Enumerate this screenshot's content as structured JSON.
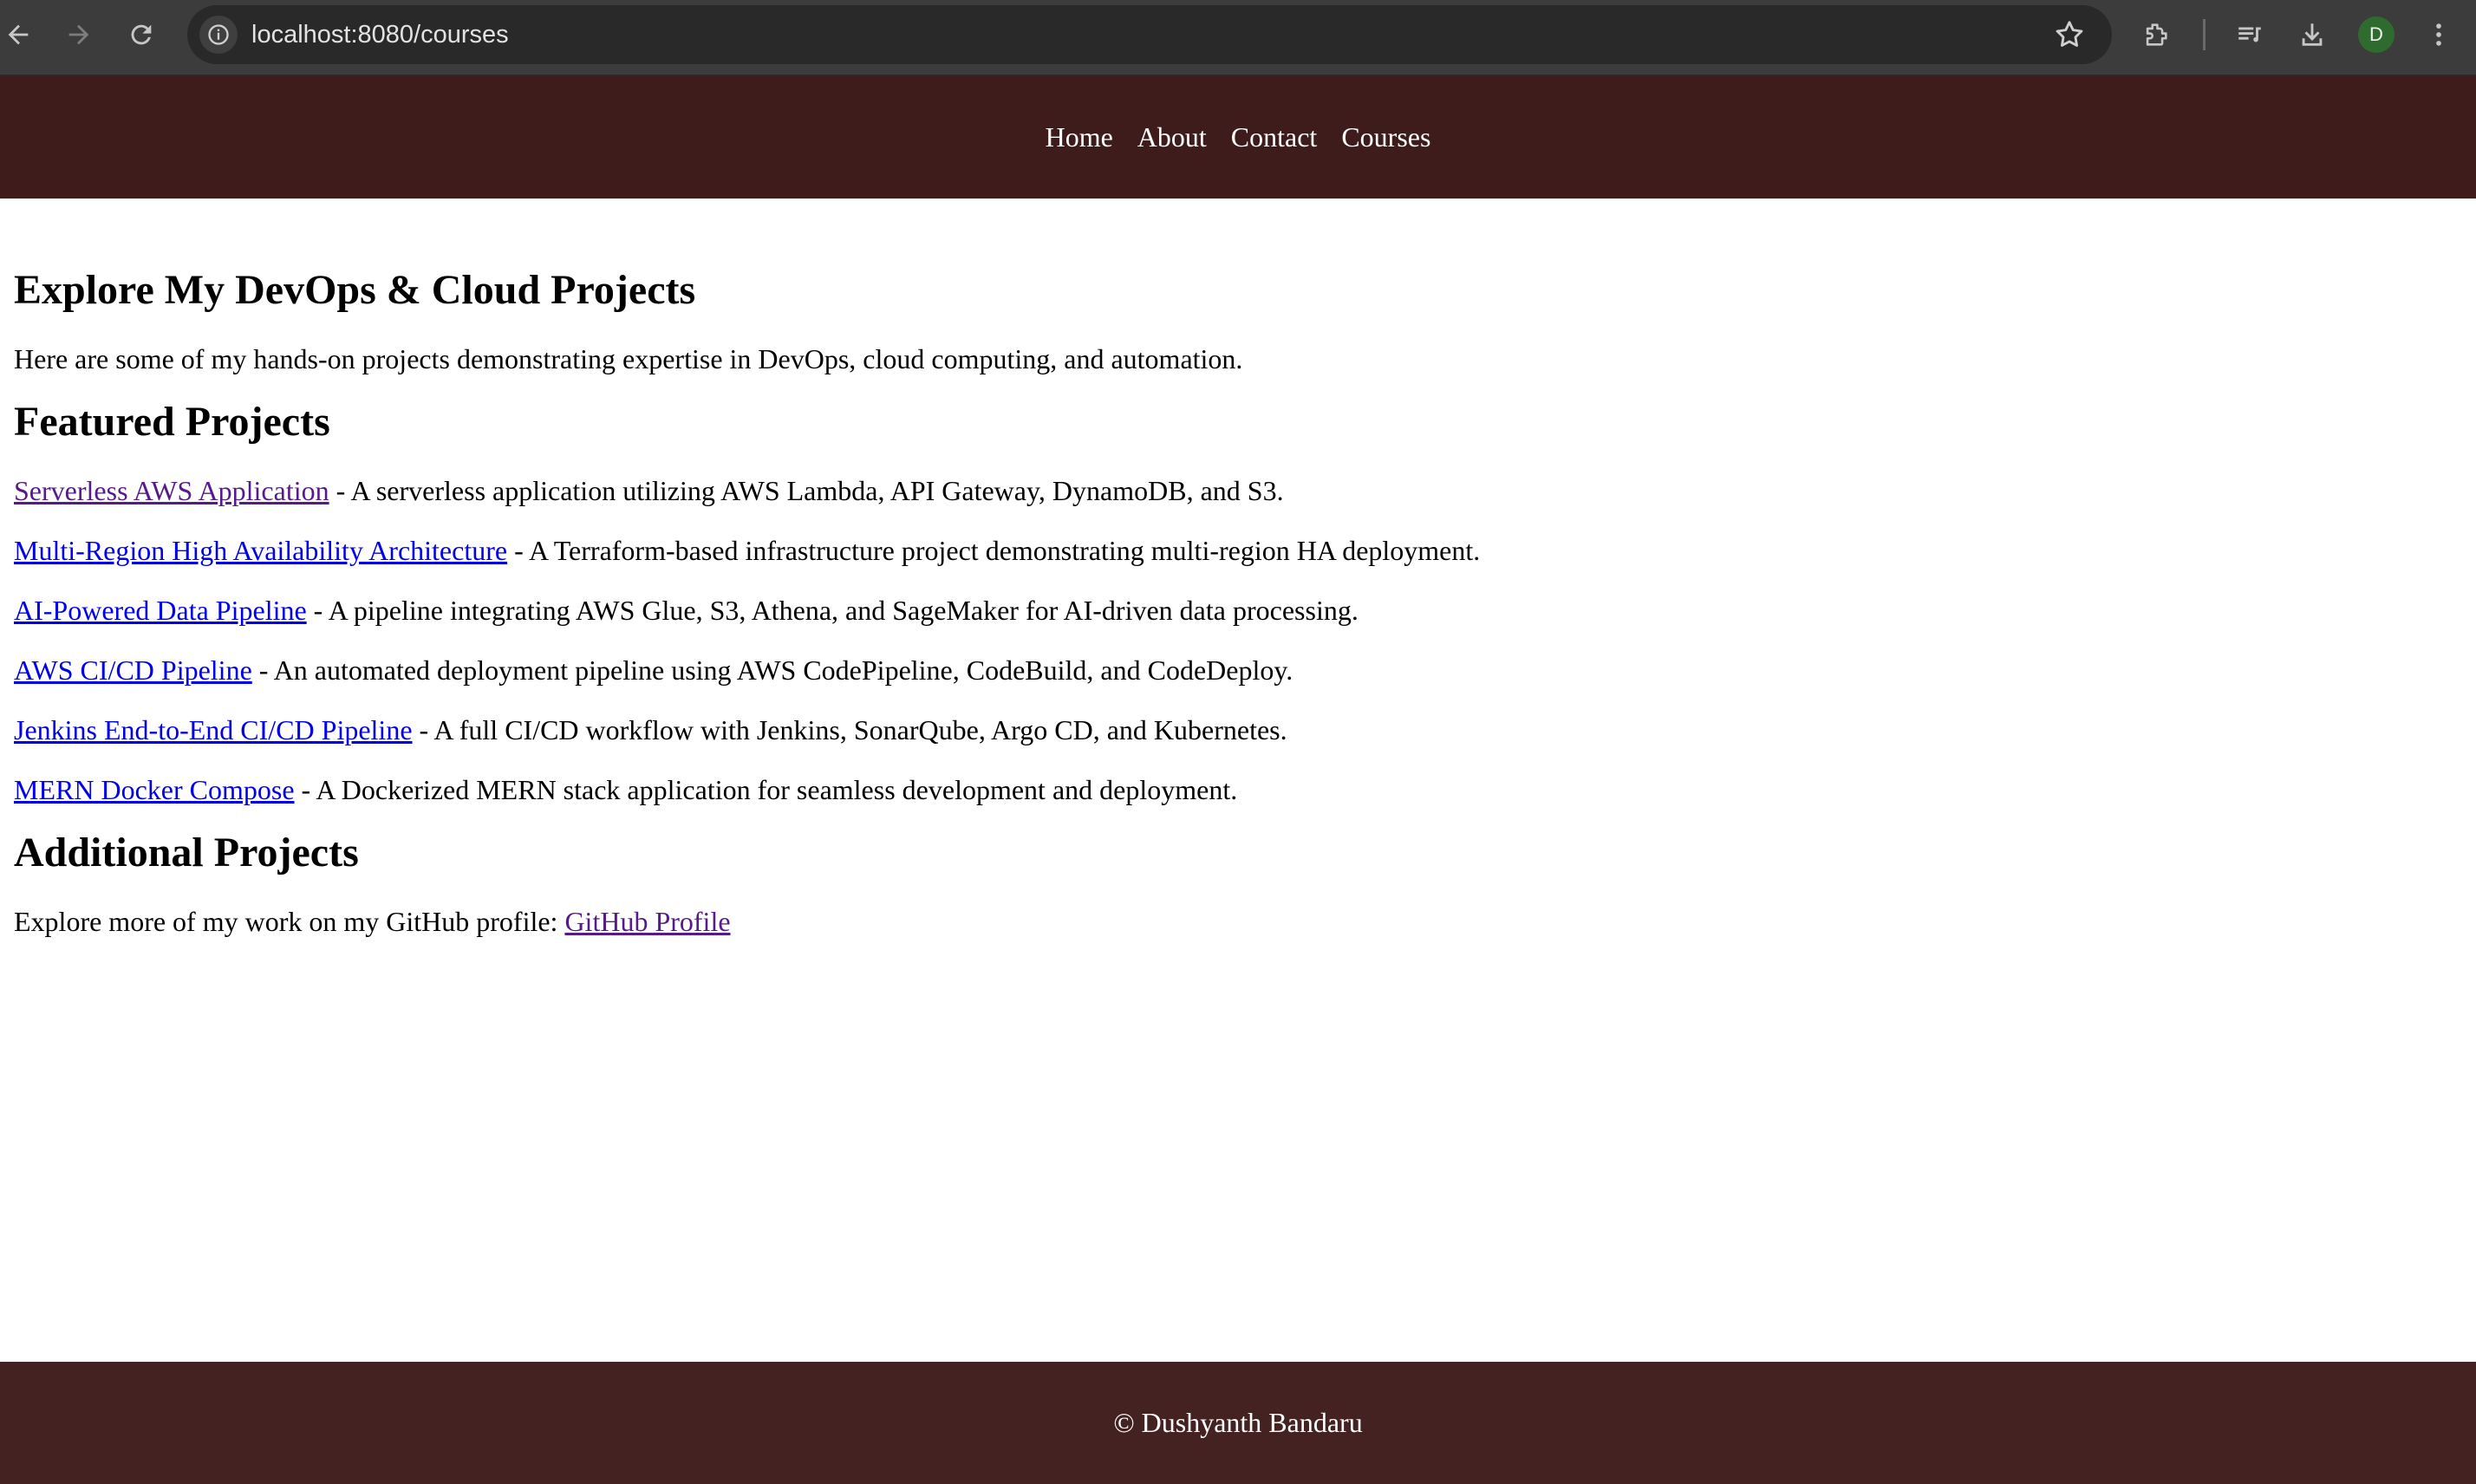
{
  "browser": {
    "url": "localhost:8080/courses",
    "avatar_letter": "D",
    "icons": [
      "back-icon",
      "forward-icon",
      "reload-icon",
      "site-info-icon",
      "star-icon",
      "extensions-icon",
      "media-icon",
      "download-icon",
      "more-icon"
    ]
  },
  "nav": {
    "items": [
      "Home",
      "About",
      "Contact",
      "Courses"
    ]
  },
  "main": {
    "title": "Explore My DevOps & Cloud Projects",
    "intro": "Here are some of my hands-on projects demonstrating expertise in DevOps, cloud computing, and automation.",
    "featured_heading": "Featured Projects",
    "projects": [
      {
        "link": "Serverless AWS Application",
        "desc": " - A serverless application utilizing AWS Lambda, API Gateway, DynamoDB, and S3."
      },
      {
        "link": "Multi-Region High Availability Architecture",
        "desc": " - A Terraform-based infrastructure project demonstrating multi-region HA deployment."
      },
      {
        "link": "AI-Powered Data Pipeline",
        "desc": " - A pipeline integrating AWS Glue, S3, Athena, and SageMaker for AI-driven data processing."
      },
      {
        "link": "AWS CI/CD Pipeline",
        "desc": " - An automated deployment pipeline using AWS CodePipeline, CodeBuild, and CodeDeploy."
      },
      {
        "link": "Jenkins End-to-End CI/CD Pipeline",
        "desc": " - A full CI/CD workflow with Jenkins, SonarQube, Argo CD, and Kubernetes."
      },
      {
        "link": "MERN Docker Compose",
        "desc": " - A Dockerized MERN stack application for seamless development and deployment."
      }
    ],
    "additional_heading": "Additional Projects",
    "github_text": "Explore more of my work on my GitHub profile: ",
    "github_link": "GitHub Profile"
  },
  "footer": {
    "text": "© Dushyanth Bandaru"
  },
  "colors": {
    "header_bg": "#3e1c1c",
    "footer_bg": "#442222",
    "link": "#0000ee",
    "visited_link": "#551a8b"
  }
}
